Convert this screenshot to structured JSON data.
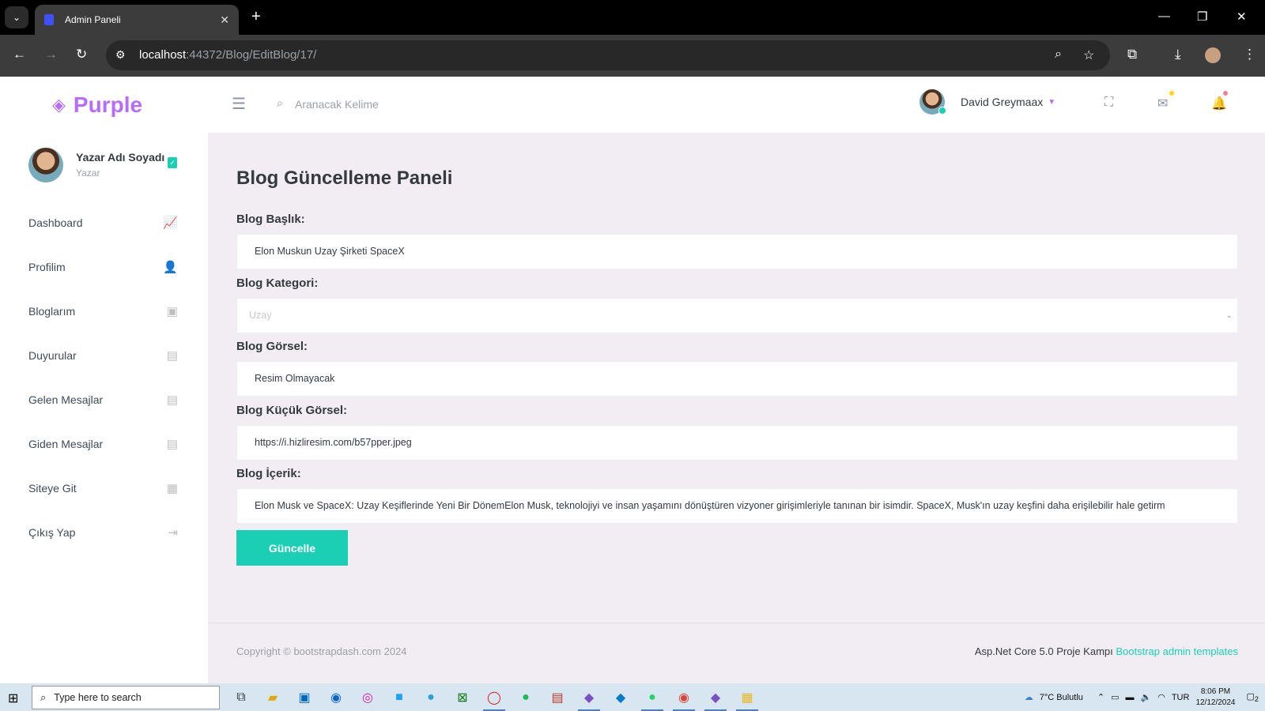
{
  "browser": {
    "tab_title": "Admin Paneli",
    "tab_close": "✕",
    "new_tab": "+",
    "url_host": "localhost",
    "url_rest": ":44372/Blog/EditBlog/17/"
  },
  "brand": {
    "name": "Purple"
  },
  "sidebar": {
    "profile_name": "Yazar Adı Soyadı",
    "profile_role": "Yazar",
    "items": [
      {
        "label": "Dashboard",
        "icon": "chart-line-icon"
      },
      {
        "label": "Profilim",
        "icon": "user-icon"
      },
      {
        "label": "Bloglarım",
        "icon": "blog-icon"
      },
      {
        "label": "Duyurular",
        "icon": "message-icon"
      },
      {
        "label": "Gelen Mesajlar",
        "icon": "message-icon"
      },
      {
        "label": "Giden Mesajlar",
        "icon": "message-icon"
      },
      {
        "label": "Siteye Git",
        "icon": "grid-icon"
      },
      {
        "label": "Çıkış Yap",
        "icon": "logout-icon"
      }
    ]
  },
  "topbar": {
    "search_placeholder": "Aranacak Kelime",
    "user_name": "David Greymaax",
    "mail_dot_color": "#fed713",
    "bell_dot_color": "#fe7c96"
  },
  "form": {
    "title": "Blog Güncelleme Paneli",
    "fields": [
      {
        "label": "Blog Başlık:",
        "value": "Elon Muskun Uzay Şirketi SpaceX"
      },
      {
        "label": "Blog Kategori:",
        "value": "Uzay"
      },
      {
        "label": "Blog Görsel:",
        "value": "Resim Olmayacak"
      },
      {
        "label": "Blog Küçük Görsel:",
        "value": "https://i.hizliresim.com/b57pper.jpeg"
      },
      {
        "label": "Blog İçerik:",
        "value": "Elon Musk ve SpaceX: Uzay Keşiflerinde Yeni Bir DönemElon Musk, teknolojiyi ve insan yaşamını dönüştüren vizyoner girişimleriyle tanınan bir isimdir. SpaceX, Musk'ın uzay keşfini daha erişilebilir hale getirm"
      }
    ],
    "submit_label": "Güncelle"
  },
  "footer": {
    "copyright": "Copyright © bootstrapdash.com 2024",
    "credits_text": "Asp.Net Core 5.0 Proje Kampı",
    "credits_link": "Bootstrap admin templates"
  },
  "taskbar": {
    "search_placeholder": "Type here to search",
    "weather": "7°C  Bulutlu",
    "lang": "TUR",
    "time": "8:06 PM",
    "date": "12/12/2024",
    "notif_count": "2"
  },
  "colors": {
    "accent": "#b66dff",
    "success": "#1bcfb4",
    "background": "#f2edf3"
  }
}
